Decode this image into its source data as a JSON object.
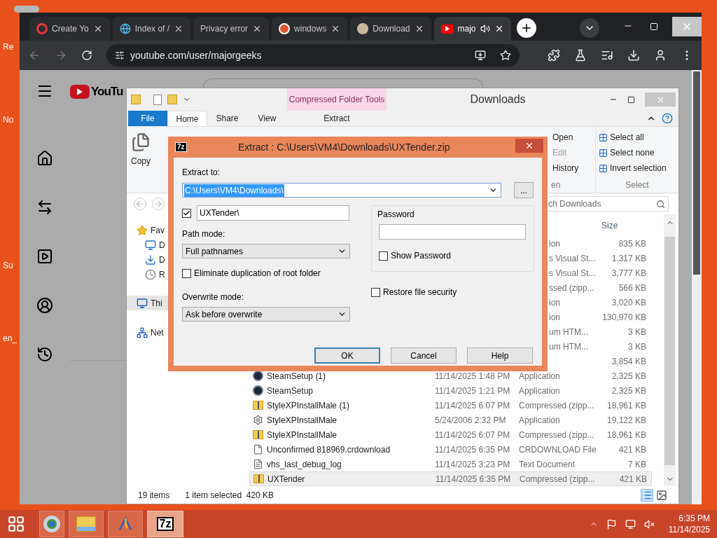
{
  "desktop_icons": [
    {
      "label": "Re"
    },
    {
      "label": "No"
    },
    {
      "label": "Su"
    },
    {
      "label": "en_"
    }
  ],
  "browser": {
    "tabs": [
      {
        "title": "Create Yo",
        "kind": "studio",
        "selected": false,
        "audio": false
      },
      {
        "title": "Index of /",
        "kind": "globe",
        "selected": false,
        "audio": false
      },
      {
        "title": "Privacy error",
        "kind": "none",
        "selected": false,
        "audio": false
      },
      {
        "title": "windows",
        "kind": "duck",
        "selected": false,
        "audio": false
      },
      {
        "title": "Download",
        "kind": "geek",
        "selected": false,
        "audio": false
      },
      {
        "title": "majo",
        "kind": "youtube",
        "selected": true,
        "audio": true
      }
    ],
    "address": "youtube.com/user/majorgeeks",
    "page": {
      "logo": "YouTu"
    }
  },
  "explorer": {
    "title": "Downloads",
    "context_group": "Compressed Folder Tools",
    "tabs": [
      {
        "label": "File",
        "kind": "file",
        "selected": false
      },
      {
        "label": "Home",
        "kind": "tab",
        "selected": true
      },
      {
        "label": "Share",
        "kind": "tab",
        "selected": false
      },
      {
        "label": "View",
        "kind": "tab",
        "selected": false
      },
      {
        "label": "Extract",
        "kind": "context",
        "selected": false
      }
    ],
    "copy_label": "Copy",
    "open_group": {
      "items": [
        {
          "label": "Open",
          "disabled": false
        },
        {
          "label": "Edit",
          "disabled": true
        },
        {
          "label": "History",
          "disabled": false
        }
      ],
      "caption": "en"
    },
    "select_group": {
      "items": [
        {
          "label": "Select all"
        },
        {
          "label": "Select none"
        },
        {
          "label": "Invert selection"
        }
      ],
      "caption": "Select"
    },
    "nav": [
      {
        "label": "Fav",
        "kind": "star",
        "selected": false
      },
      {
        "label": "D",
        "kind": "desktop",
        "selected": false
      },
      {
        "label": "D",
        "kind": "downloads",
        "selected": false
      },
      {
        "label": "R",
        "kind": "recent",
        "selected": false
      },
      {
        "label": "Thi",
        "kind": "pc",
        "selected": true
      },
      {
        "label": "Net",
        "kind": "network",
        "selected": false
      }
    ],
    "search_placeholder": "ch Downloads",
    "size_column": "Size",
    "files": [
      {
        "kind": "partial",
        "type": "ion",
        "size": "835 KB",
        "selected": false
      },
      {
        "kind": "partial",
        "type": "s Visual St...",
        "size": "1,317 KB",
        "selected": false
      },
      {
        "kind": "partial",
        "type": "s Visual St...",
        "size": "3,777 KB",
        "selected": false
      },
      {
        "kind": "partial",
        "type": "ssed (zipp...",
        "size": "566 KB",
        "selected": false
      },
      {
        "kind": "partial",
        "type": "ion",
        "size": "3,020 KB",
        "selected": false
      },
      {
        "kind": "partial",
        "type": "ion",
        "size": "130,970 KB",
        "selected": false
      },
      {
        "kind": "partial",
        "type": "um HTM...",
        "size": "3 KB",
        "selected": false
      },
      {
        "kind": "partial",
        "type": "um HTM...",
        "size": "3 KB",
        "selected": false
      },
      {
        "kind": "partial",
        "size": "3,854 KB",
        "selected": false
      },
      {
        "kind": "steam",
        "name": "SteamSetup (1)",
        "date": "11/14/2025 1:48 PM",
        "type": "Application",
        "size": "2,325 KB",
        "selected": false
      },
      {
        "kind": "steam",
        "name": "SteamSetup",
        "date": "11/14/2025 1:21 PM",
        "type": "Application",
        "size": "2,325 KB",
        "selected": false
      },
      {
        "kind": "zip",
        "name": "StyleXPInstallMale (1)",
        "date": "11/14/2025 6:07 PM",
        "type": "Compressed (zipp...",
        "size": "18,961 KB",
        "selected": false
      },
      {
        "kind": "setup",
        "name": "StyleXPInstallMale",
        "date": "5/24/2006 2:32 PM",
        "type": "Application",
        "size": "19,122 KB",
        "selected": false
      },
      {
        "kind": "zip",
        "name": "StyleXPInstallMale",
        "date": "11/14/2025 6:07 PM",
        "type": "Compressed (zipp...",
        "size": "18,961 KB",
        "selected": false
      },
      {
        "kind": "blank",
        "name": "Unconfirmed 818969.crdownload",
        "date": "11/14/2025 6:35 PM",
        "type": "CRDOWNLOAD File",
        "size": "421 KB",
        "selected": false
      },
      {
        "kind": "text",
        "name": "vhs_last_debug_log",
        "date": "11/14/2025 3:23 PM",
        "type": "Text Document",
        "size": "7 KB",
        "selected": false
      },
      {
        "kind": "zip",
        "name": "UXTender",
        "date": "11/14/2025 6:35 PM",
        "type": "Compressed (zipp...",
        "size": "421 KB",
        "selected": true
      }
    ],
    "status": {
      "count": "19 items",
      "selection": "1 item selected  420 KB"
    }
  },
  "dialog": {
    "icon": "7z",
    "title": "Extract : C:\\Users\\VM4\\Downloads\\UXTender.zip",
    "extract_to_label": "Extract to:",
    "extract_to": "C:\\Users\\VM4\\Downloads\\",
    "browse": "...",
    "subfolder": {
      "checked": true,
      "value": "UXTender\\"
    },
    "path_mode": {
      "label": "Path mode:",
      "value": "Full pathnames"
    },
    "eliminate": {
      "label": "Eliminate duplication of root folder",
      "checked": false
    },
    "overwrite": {
      "label": "Overwrite mode:",
      "value": "Ask before overwrite"
    },
    "password": {
      "label": "Password",
      "show_label": "Show Password",
      "show": false
    },
    "restore": {
      "label": "Restore file security",
      "checked": false
    },
    "buttons": [
      {
        "label": "OK",
        "default": true
      },
      {
        "label": "Cancel",
        "default": false
      },
      {
        "label": "Help",
        "default": false
      }
    ]
  },
  "taskbar": {
    "apps": [
      {
        "kind": "chrome",
        "selected": false
      },
      {
        "kind": "explorer",
        "selected": false
      },
      {
        "kind": "tool",
        "selected": false
      },
      {
        "kind": "sevenzip",
        "label": "7z",
        "selected": true
      }
    ],
    "time": "6:35 PM",
    "date": "11/14/2025"
  }
}
